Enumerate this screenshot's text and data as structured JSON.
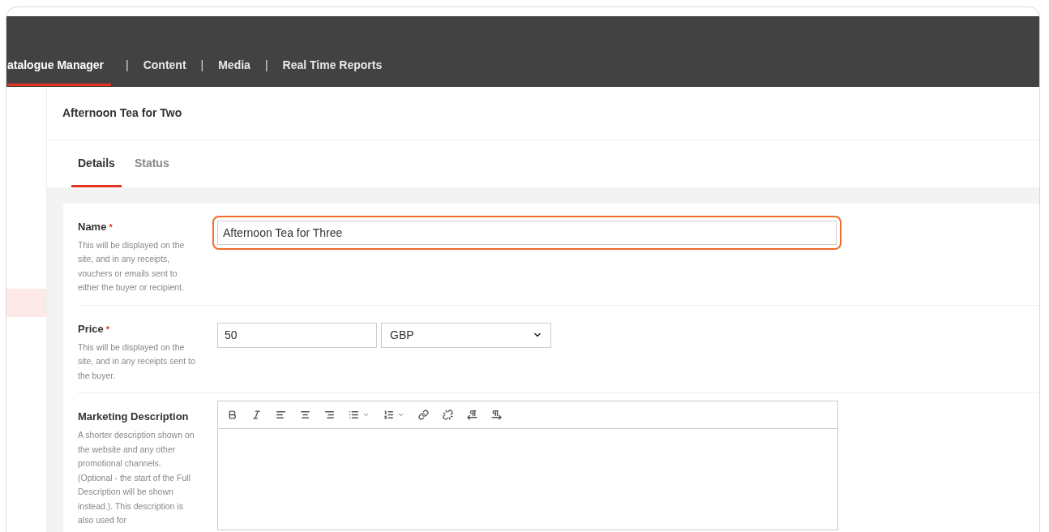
{
  "nav": [
    {
      "label": "atalogue Manager",
      "selected": true
    },
    {
      "label": "Content",
      "selected": false
    },
    {
      "label": "Media",
      "selected": false
    },
    {
      "label": "Real Time Reports",
      "selected": false
    }
  ],
  "nav_separator": "|",
  "page_title": "Afternoon Tea for Two",
  "tabs": [
    {
      "label": "Details",
      "selected": true
    },
    {
      "label": "Status",
      "selected": false
    }
  ],
  "form": [
    {
      "kind": "text",
      "label": "Name",
      "required": true,
      "help": "This will be displayed on the site, and in any receipts, vouchers or emails sent to either the buyer or recipient.",
      "value": "Afternoon Tea for Three",
      "focused": true
    },
    {
      "kind": "price",
      "label": "Price",
      "required": true,
      "help": "This will be displayed on the site, and in any receipts sent to the buyer.",
      "value": "50",
      "currency": "GBP"
    },
    {
      "kind": "editor",
      "label": "Marketing Description",
      "required": false,
      "help": "A shorter description shown on the website and any other promotional channels. (Optional - the start of the Full Description will be shown instead.). This description is also used for"
    }
  ],
  "required_mark": "*"
}
